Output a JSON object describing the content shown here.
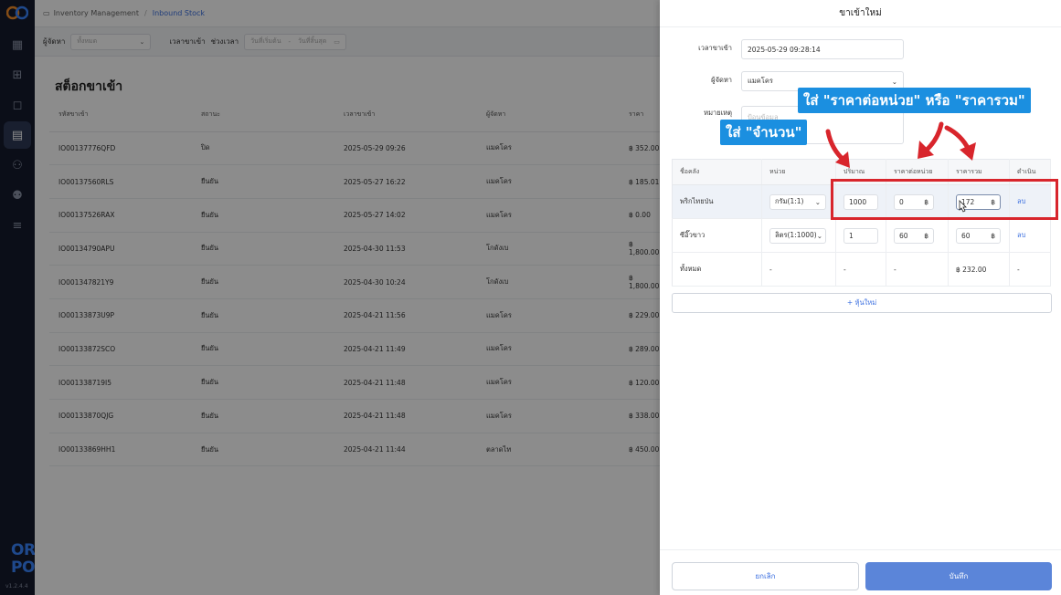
{
  "colors": {
    "accent": "#3b6fe0",
    "sidebar": "#151b2d",
    "status_ok": "#2f9b46",
    "highlight": "#d8252c",
    "callout": "#1b8fe0"
  },
  "breadcrumb": {
    "parent": "Inventory Management",
    "current": "Inbound Stock"
  },
  "filters": {
    "supplier_label": "ผู้จัดหา",
    "supplier_value": "ทั้งหมด",
    "time_label": "เวลาขาเข้า",
    "range_label": "ช่วงเวลา",
    "start_placeholder": "วันที่เริ่มต้น",
    "dash": "-",
    "end_placeholder": "วันที่สิ้นสุด"
  },
  "page_title": "สต็อกขาเข้า",
  "table": {
    "headers": [
      "รหัสขาเข้า",
      "สถานะ",
      "เวลาขาเข้า",
      "ผู้จัดหา",
      "ราคา"
    ],
    "rows": [
      [
        "IO00137776QFD",
        "ปิด",
        "2025-05-29 09:26",
        "แมคโคร",
        "฿ 352.00"
      ],
      [
        "IO00137560RLS",
        "ยืนยัน",
        "2025-05-27 16:22",
        "แมคโคร",
        "฿ 185.01"
      ],
      [
        "IO00137526RAX",
        "ยืนยัน",
        "2025-05-27 14:02",
        "แมคโคร",
        "฿ 0.00"
      ],
      [
        "IO00134790APU",
        "ยืนยัน",
        "2025-04-30 11:53",
        "โกดังเบ",
        "฿ 1,800.00"
      ],
      [
        "IO001347821Y9",
        "ยืนยัน",
        "2025-04-30 10:24",
        "โกดังเบ",
        "฿ 1,800.00"
      ],
      [
        "IO00133873U9P",
        "ยืนยัน",
        "2025-04-21 11:56",
        "แมคโคร",
        "฿ 229.00"
      ],
      [
        "IO00133872SCO",
        "ยืนยัน",
        "2025-04-21 11:49",
        "แมคโคร",
        "฿ 289.00"
      ],
      [
        "IO001338719I5",
        "ยืนยัน",
        "2025-04-21 11:48",
        "แมคโคร",
        "฿ 120.00"
      ],
      [
        "IO00133870QJG",
        "ยืนยัน",
        "2025-04-21 11:48",
        "แมคโคร",
        "฿ 338.00"
      ],
      [
        "IO00133869HH1",
        "ยืนยัน",
        "2025-04-21 11:44",
        "ตลาดไท",
        "฿ 450.00"
      ]
    ]
  },
  "drawer": {
    "title": "ขาเข้าใหม่",
    "time_label": "เวลาขาเข้า",
    "time_value": "2025-05-29 09:28:14",
    "supplier_label": "ผู้จัดหา",
    "supplier_value": "แมคโคร",
    "note_label": "หมายเหตุ",
    "note_placeholder": "ป้อนข้อมูล",
    "item_headers": [
      "ชื่อคลัง",
      "หน่วย",
      "ปริมาณ",
      "ราคาต่อหน่วย",
      "ราคารวม",
      "ดำเนิน"
    ],
    "items": [
      {
        "name": "พริกไทยป่น",
        "unit": "กรัม(1:1)",
        "qty": "1000",
        "unit_price": "0",
        "total": "172",
        "action": "ลบ"
      },
      {
        "name": "ซีอิ๊วขาว",
        "unit": "ลิตร(1:1000)",
        "qty": "1",
        "unit_price": "60",
        "total": "60",
        "action": "ลบ"
      }
    ],
    "summary": {
      "label": "ทั้งหมด",
      "unit": "-",
      "qty": "-",
      "unit_price": "-",
      "total": "฿ 232.00",
      "action": "-"
    },
    "currency": "฿",
    "add_label": "+ หุ้นใหม่",
    "cancel_label": "ยกเลิก",
    "save_label": "บันทึก"
  },
  "annotations": {
    "price_callout": "ใส่ \"ราคาต่อหน่วย\" หรือ \"ราคารวม\"",
    "qty_callout": "ใส่ \"จำนวน\""
  },
  "brand": {
    "line1": "ORDER",
    "line2": "POS",
    "version": "v1.2.4.4"
  },
  "icons": [
    "logo-icon",
    "dashboard-icon",
    "sales-icon",
    "bag-icon",
    "inventory-icon",
    "users-icon",
    "user-settings-icon",
    "sliders-icon",
    "calendar-icon",
    "chevron-down-icon",
    "cursor-icon"
  ]
}
